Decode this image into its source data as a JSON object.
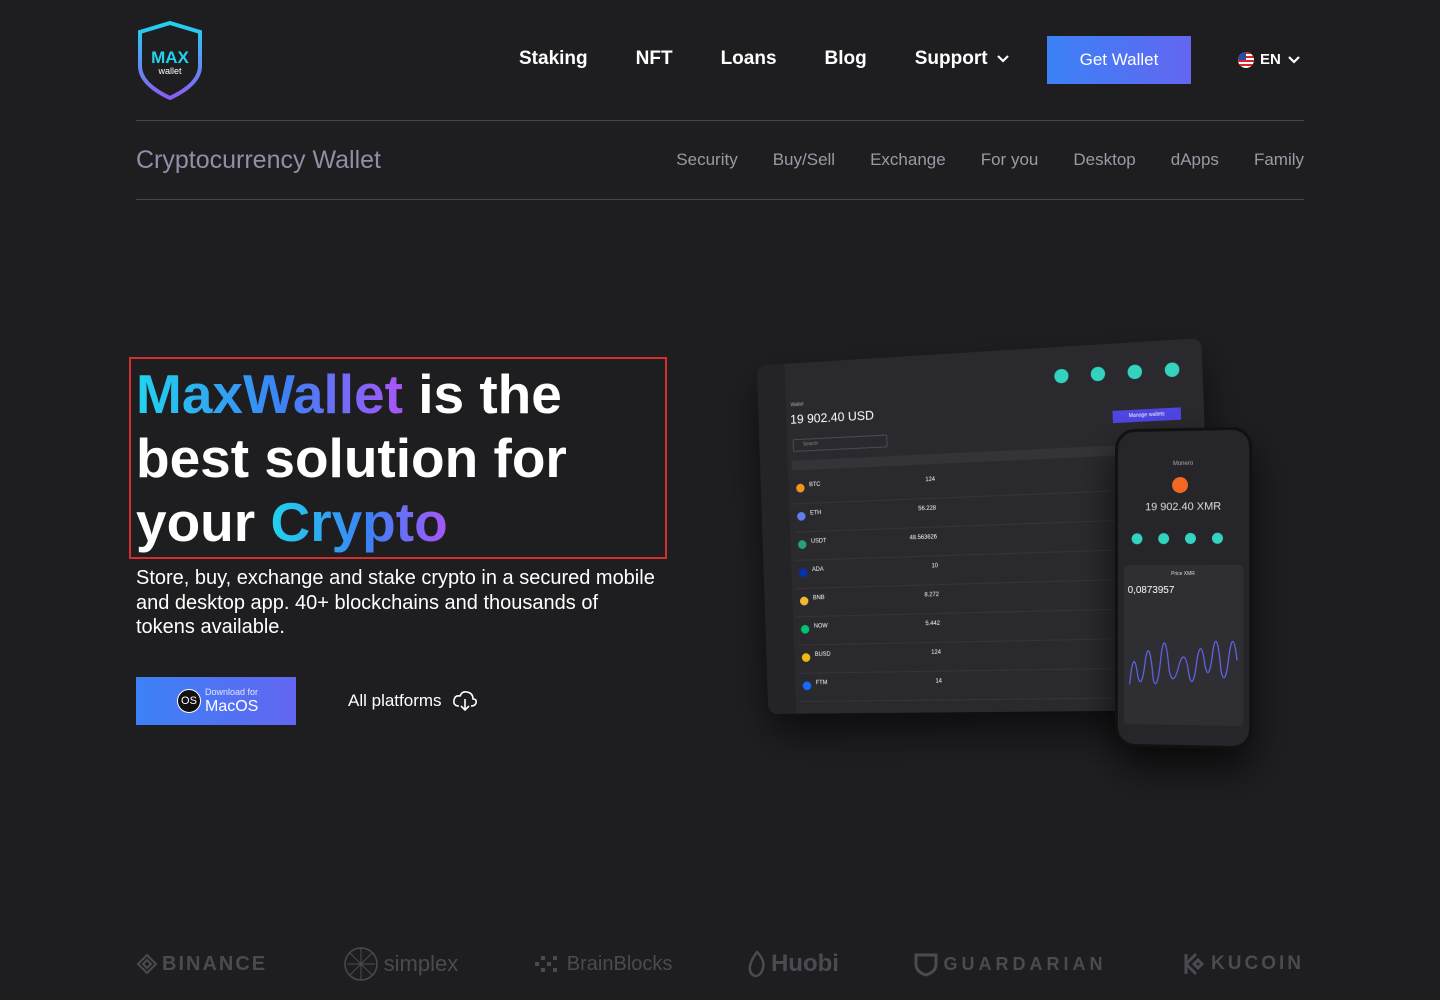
{
  "brand": {
    "logo_text_main": "MAX",
    "logo_text_sub": "wallet"
  },
  "nav": {
    "items": [
      "Staking",
      "NFT",
      "Loans",
      "Blog",
      "Support"
    ],
    "get_wallet": "Get Wallet",
    "language": "EN"
  },
  "subheader": {
    "title": "Cryptocurrency Wallet",
    "links": [
      "Security",
      "Buy/Sell",
      "Exchange",
      "For you",
      "Desktop",
      "dApps",
      "Family"
    ]
  },
  "hero": {
    "title_grad1": "MaxWallet",
    "title_part1": " is the best solution for your ",
    "title_grad2": "Crypto",
    "description": "Store, buy, exchange and stake crypto in a secured mobile and desktop app. 40+ blockchains and thousands of tokens available.",
    "download_small": "Download for",
    "download_big": "MacOS",
    "download_os_badge": "OS",
    "all_platforms": "All platforms"
  },
  "tablet": {
    "wallet_label": "Wallet",
    "balance": "19 902.40 USD",
    "search_placeholder": "Search",
    "manage_wallets": "Manage wallets",
    "rows": [
      {
        "symbol": "BTC",
        "balance": "124",
        "color": "#f7931a"
      },
      {
        "symbol": "ETH",
        "balance": "56.228",
        "color": "#627eea"
      },
      {
        "symbol": "USDT",
        "balance": "48.563626",
        "color": "#26a17b"
      },
      {
        "symbol": "ADA",
        "balance": "10",
        "color": "#0033ad"
      },
      {
        "symbol": "BNB",
        "balance": "8.272",
        "color": "#f3ba2f"
      },
      {
        "symbol": "NOW",
        "balance": "5.442",
        "color": "#00c26f"
      },
      {
        "symbol": "BUSD",
        "balance": "124",
        "color": "#f0b90b"
      },
      {
        "symbol": "FTM",
        "balance": "14",
        "color": "#1969ff"
      }
    ]
  },
  "phone": {
    "coin_name": "Monero",
    "balance": "19 902.40 XMR",
    "price_label": "Price XMR",
    "price_value": "0,0873957"
  },
  "partners": [
    "BINANCE",
    "simplex",
    "BrainBlocks",
    "Huobi",
    "GUARDARIAN",
    "KUCOIN"
  ]
}
